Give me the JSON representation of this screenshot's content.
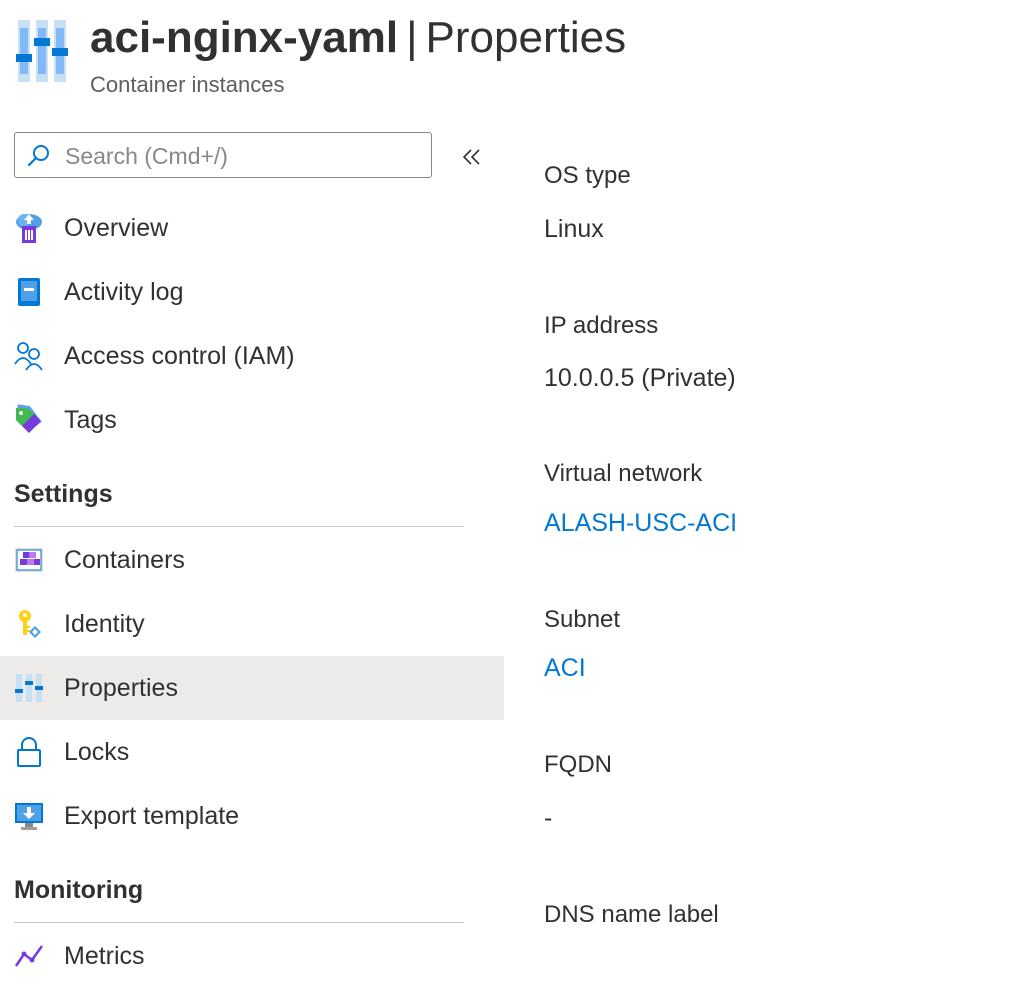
{
  "header": {
    "resource_name": "aci-nginx-yaml",
    "separator": "|",
    "page_title": "Properties",
    "subtitle": "Container instances",
    "icon": "properties-sliders-icon"
  },
  "search": {
    "placeholder": "Search (Cmd+/)",
    "value": "",
    "collapse_icon": "double-chevron-left-icon"
  },
  "nav": {
    "top_items": [
      {
        "label": "Overview",
        "icon": "overview-cloud-icon"
      },
      {
        "label": "Activity log",
        "icon": "activity-log-icon"
      },
      {
        "label": "Access control (IAM)",
        "icon": "people-icon"
      },
      {
        "label": "Tags",
        "icon": "tag-icon"
      }
    ],
    "settings": {
      "title": "Settings",
      "items": [
        {
          "label": "Containers",
          "icon": "containers-icon"
        },
        {
          "label": "Identity",
          "icon": "key-icon"
        },
        {
          "label": "Properties",
          "icon": "properties-sliders-icon",
          "active": true
        },
        {
          "label": "Locks",
          "icon": "lock-icon"
        },
        {
          "label": "Export template",
          "icon": "export-template-icon"
        }
      ]
    },
    "monitoring": {
      "title": "Monitoring",
      "items": [
        {
          "label": "Metrics",
          "icon": "metrics-icon"
        }
      ]
    }
  },
  "properties": [
    {
      "label": "OS type",
      "value": "Linux",
      "is_link": false
    },
    {
      "label": "IP address",
      "value": "10.0.0.5 (Private)",
      "is_link": false
    },
    {
      "label": "Virtual network",
      "value": "ALASH-USC-ACI",
      "is_link": true
    },
    {
      "label": "Subnet",
      "value": "ACI",
      "is_link": true
    },
    {
      "label": "FQDN",
      "value": "-",
      "is_link": false
    },
    {
      "label": "DNS name label",
      "value": "",
      "is_link": false
    }
  ],
  "colors": {
    "accent_link": "#0078d4",
    "active_bg": "#edebe9",
    "text": "#323130",
    "subtle_text": "#605e5c"
  }
}
